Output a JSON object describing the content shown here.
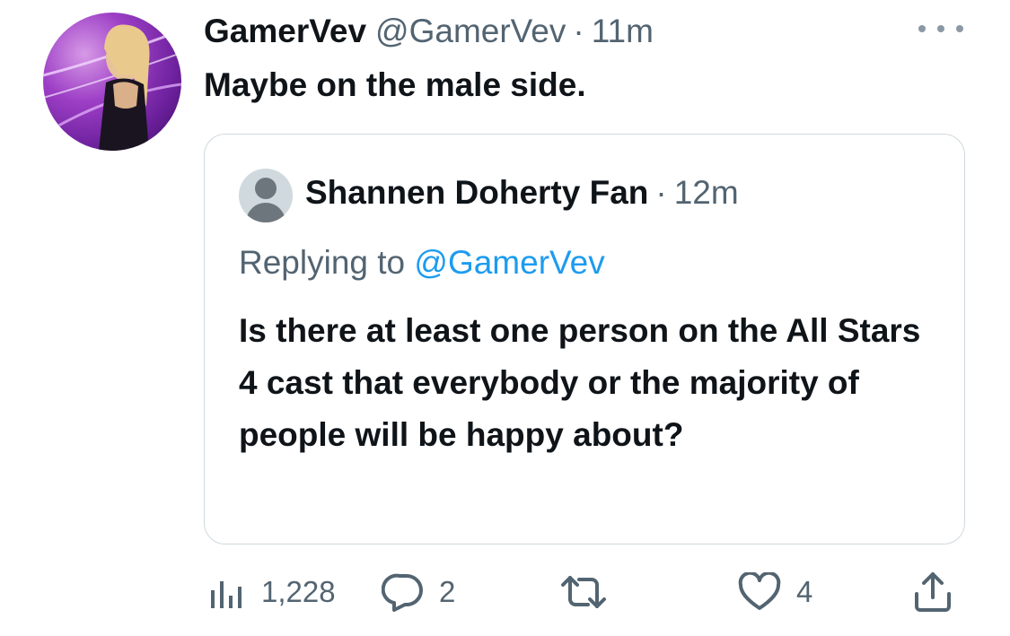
{
  "tweet": {
    "author_name": "GamerVev",
    "author_handle": "@GamerVev",
    "separator": "·",
    "time": "11m",
    "text": "Maybe on the male side."
  },
  "quoted_tweet": {
    "author_name": "Shannen Doherty Fan",
    "separator": "·",
    "time": "12m",
    "replying_prefix": "Replying to",
    "replying_to": "@GamerVev",
    "text": "Is there at least one person on the All Stars 4 cast that everybody or the majority of people will be happy about?"
  },
  "actions": {
    "views": "1,228",
    "replies": "2",
    "likes": "4"
  },
  "icons": {
    "more": "more-icon",
    "views": "views-icon",
    "reply": "reply-icon",
    "retweet": "retweet-icon",
    "like": "like-icon",
    "share": "share-icon"
  },
  "colors": {
    "text": "#0f1419",
    "muted": "#536471",
    "link": "#1d9bf0",
    "border": "#cfd9de"
  }
}
